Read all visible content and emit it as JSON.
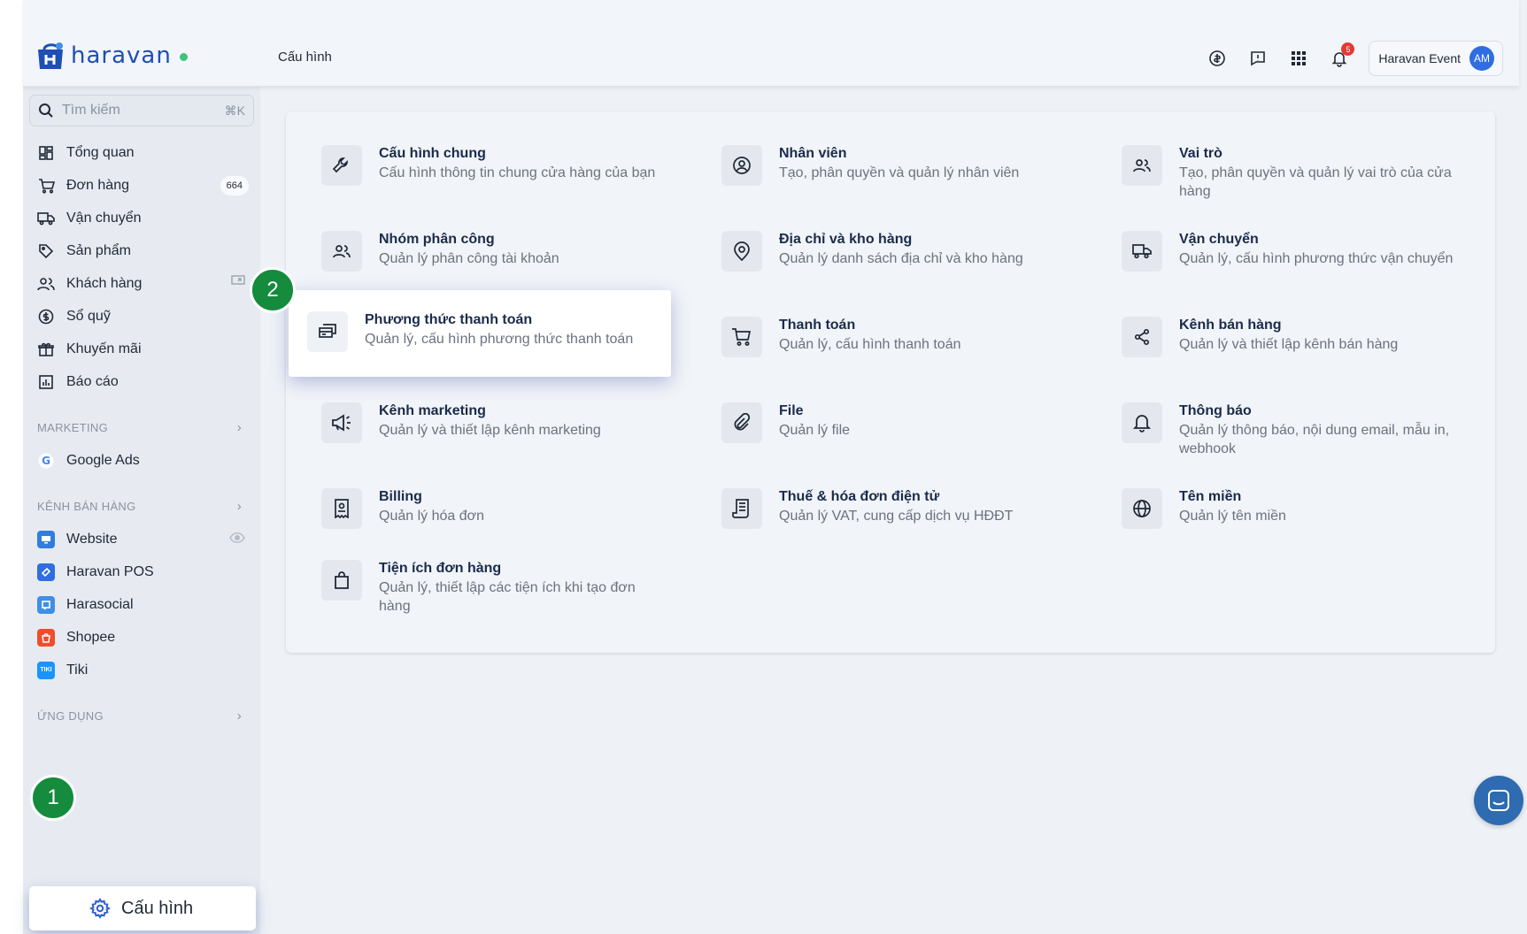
{
  "app": {
    "brand": "haravan",
    "page_title": "Cấu hình"
  },
  "topbar": {
    "notification_count": "5",
    "user_name": "Haravan Event",
    "avatar_initials": "AM"
  },
  "search": {
    "placeholder": "Tìm kiếm",
    "shortcut": "⌘K"
  },
  "sidebar": {
    "items": [
      {
        "label": "Tổng quan",
        "icon": "dashboard-icon"
      },
      {
        "label": "Đơn hàng",
        "icon": "cart-icon",
        "count": "664"
      },
      {
        "label": "Vận chuyển",
        "icon": "truck-icon"
      },
      {
        "label": "Sản phẩm",
        "icon": "tag-icon"
      },
      {
        "label": "Khách hàng",
        "icon": "users-icon"
      },
      {
        "label": "Sổ quỹ",
        "icon": "dollar-icon"
      },
      {
        "label": "Khuyến mãi",
        "icon": "gift-icon"
      },
      {
        "label": "Báo cáo",
        "icon": "chart-icon"
      }
    ],
    "marketing": {
      "title": "MARKETING",
      "items": [
        {
          "label": "Google Ads"
        }
      ]
    },
    "channels": {
      "title": "KÊNH BÁN HÀNG",
      "items": [
        {
          "label": "Website",
          "color": "#2f7de1"
        },
        {
          "label": "Haravan POS",
          "color": "#2f6de1"
        },
        {
          "label": "Harasocial",
          "color": "#3f8fe4"
        },
        {
          "label": "Shopee",
          "color": "#ee4d2d"
        },
        {
          "label": "Tiki",
          "color": "#1a94ff",
          "badge": "TIKI"
        }
      ]
    },
    "apps": {
      "title": "ỨNG DỤNG"
    },
    "config_button": {
      "label": "Cấu hình"
    }
  },
  "steps": {
    "one": "1",
    "two": "2"
  },
  "settings": [
    {
      "title": "Cấu hình chung",
      "desc": "Cấu hình thông tin chung cửa hàng của bạn",
      "icon": "wrench-icon"
    },
    {
      "title": "Nhân viên",
      "desc": "Tạo, phân quyền và quản lý nhân viên",
      "icon": "user-circle-icon"
    },
    {
      "title": "Vai trò",
      "desc": "Tạo, phân quyền và quản lý vai trò của cửa hàng",
      "icon": "users-icon"
    },
    {
      "title": "Nhóm phân công",
      "desc": "Quản lý phân công tài khoản",
      "icon": "group-icon"
    },
    {
      "title": "Địa chỉ và kho hàng",
      "desc": "Quản lý danh sách địa chỉ và kho hàng",
      "icon": "location-pin-icon"
    },
    {
      "title": "Vận chuyển",
      "desc": "Quản lý, cấu hình phương thức vận chuyển",
      "icon": "truck-icon"
    },
    {
      "title": "Phương thức thanh toán",
      "desc": "Quản lý, cấu hình phương thức thanh toán",
      "icon": "payment-card-icon"
    },
    {
      "title": "Thanh toán",
      "desc": "Quản lý, cấu hình thanh toán",
      "icon": "cart-icon"
    },
    {
      "title": "Kênh bán hàng",
      "desc": "Quản lý và thiết lập kênh bán hàng",
      "icon": "share-icon"
    },
    {
      "title": "Kênh marketing",
      "desc": "Quản lý và thiết lập kênh marketing",
      "icon": "megaphone-icon"
    },
    {
      "title": "File",
      "desc": "Quản lý file",
      "icon": "paperclip-icon"
    },
    {
      "title": "Thông báo",
      "desc": "Quản lý thông báo, nội dung email, mẫu in, webhook",
      "icon": "bell-icon"
    },
    {
      "title": "Billing",
      "desc": "Quản lý hóa đơn",
      "icon": "billing-icon"
    },
    {
      "title": "Thuế & hóa đơn điện tử",
      "desc": "Quản lý VAT, cung cấp dịch vụ HĐĐT",
      "icon": "receipt-icon"
    },
    {
      "title": "Tên miền",
      "desc": "Quản lý tên miền",
      "icon": "globe-icon"
    },
    {
      "title": "Tiện ích đơn hàng",
      "desc": "Quản lý, thiết lập các tiện ích khi tạo đơn hàng",
      "icon": "shopping-bag-icon"
    }
  ]
}
